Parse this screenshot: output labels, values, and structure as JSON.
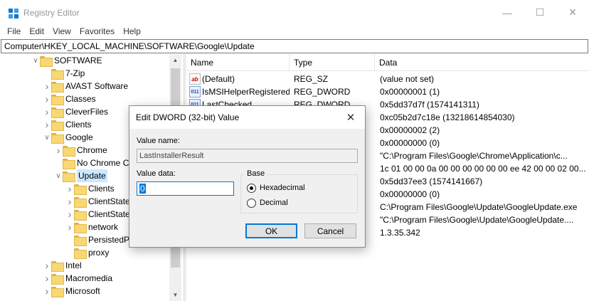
{
  "window": {
    "title": "Registry Editor"
  },
  "menu": [
    "File",
    "Edit",
    "View",
    "Favorites",
    "Help"
  ],
  "address": "Computer\\HKEY_LOCAL_MACHINE\\SOFTWARE\\Google\\Update",
  "tree": [
    {
      "label": "SOFTWARE",
      "chevron": "v",
      "indent": 1,
      "selected": false
    },
    {
      "label": "7-Zip",
      "chevron": "",
      "indent": 2,
      "selected": false
    },
    {
      "label": "AVAST Software",
      "chevron": ">",
      "indent": 2,
      "selected": false
    },
    {
      "label": "Classes",
      "chevron": ">",
      "indent": 2,
      "selected": false
    },
    {
      "label": "CleverFiles",
      "chevron": ">",
      "indent": 2,
      "selected": false
    },
    {
      "label": "Clients",
      "chevron": ">",
      "indent": 2,
      "selected": false
    },
    {
      "label": "Google",
      "chevron": "v",
      "indent": 2,
      "selected": false
    },
    {
      "label": "Chrome",
      "chevron": ">",
      "indent": 3,
      "selected": false
    },
    {
      "label": "No Chrome C",
      "chevron": "",
      "indent": 3,
      "selected": false
    },
    {
      "label": "Update",
      "chevron": "v",
      "indent": 3,
      "selected": true
    },
    {
      "label": "Clients",
      "chevron": ">",
      "indent": 4,
      "selected": false
    },
    {
      "label": "ClientState",
      "chevron": ">",
      "indent": 4,
      "selected": false
    },
    {
      "label": "ClientState",
      "chevron": ">",
      "indent": 4,
      "selected": false
    },
    {
      "label": "network",
      "chevron": ">",
      "indent": 4,
      "selected": false
    },
    {
      "label": "PersistedP",
      "chevron": "",
      "indent": 4,
      "selected": false
    },
    {
      "label": "proxy",
      "chevron": "",
      "indent": 4,
      "selected": false
    },
    {
      "label": "Intel",
      "chevron": ">",
      "indent": 2,
      "selected": false
    },
    {
      "label": "Macromedia",
      "chevron": ">",
      "indent": 2,
      "selected": false
    },
    {
      "label": "Microsoft",
      "chevron": ">",
      "indent": 2,
      "selected": false
    }
  ],
  "list": {
    "columns": [
      "Name",
      "Type",
      "Data"
    ],
    "rows": [
      {
        "icon": "ab",
        "name": "(Default)",
        "type": "REG_SZ",
        "data": "(value not set)"
      },
      {
        "icon": "011",
        "name": "IsMSIHelperRegistered",
        "type": "REG_DWORD",
        "data": "0x00000001 (1)"
      },
      {
        "icon": "011",
        "name": "LastChecked",
        "type": "REG_DWORD",
        "data": "0x5dd37d7f (1574141311)"
      },
      {
        "icon": "",
        "name": "",
        "type": "",
        "data": "0xc05b2d7c18e (13218614854030)"
      },
      {
        "icon": "",
        "name": "",
        "type": "",
        "data": "0x00000002 (2)"
      },
      {
        "icon": "",
        "name": "",
        "type": "",
        "data": "0x00000000 (0)"
      },
      {
        "icon": "",
        "name": "",
        "type": "",
        "data": "\"C:\\Program Files\\Google\\Chrome\\Application\\c..."
      },
      {
        "icon": "",
        "name": "",
        "type": "",
        "data": "1c 01 00 00 0a 00 00 00 00 00 00 ee 42 00 00 02 00..."
      },
      {
        "icon": "",
        "name": "",
        "type": "",
        "data": "0x5dd37ee3 (1574141667)"
      },
      {
        "icon": "",
        "name": "",
        "type": "",
        "data": "0x00000000 (0)"
      },
      {
        "icon": "",
        "name": "",
        "type": "",
        "data": "C:\\Program Files\\Google\\Update\\GoogleUpdate.exe"
      },
      {
        "icon": "",
        "name": "",
        "type": "",
        "data": "\"C:\\Program Files\\Google\\Update\\GoogleUpdate...."
      },
      {
        "icon": "",
        "name": "",
        "type": "",
        "data": "1.3.35.342"
      }
    ]
  },
  "dialog": {
    "title": "Edit DWORD (32-bit) Value",
    "value_name_label": "Value name:",
    "value_name": "LastInstallerResult",
    "value_data_label": "Value data:",
    "value_data": "0",
    "base_label": "Base",
    "hex_label": "Hexadecimal",
    "dec_label": "Decimal",
    "ok_label": "OK",
    "cancel_label": "Cancel"
  }
}
